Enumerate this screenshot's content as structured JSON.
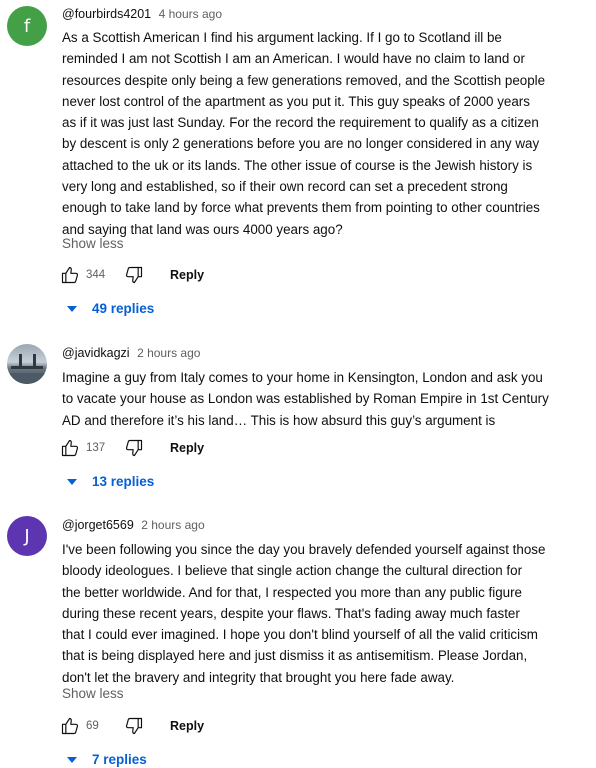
{
  "comments": [
    {
      "avatar_letter": "f",
      "avatar_color": "#43a047",
      "author": "@fourbirds4201",
      "time": "4 hours ago",
      "lines": [
        "As a Scottish American I find his argument lacking. If I go to Scotland ill be",
        "reminded I am not Scottish I am an American. I would have no claim to land or",
        "resources despite only being a few generations removed, and the Scottish people",
        "never lost control of the apartment as you put it. This guy speaks of 2000 years",
        "as if it was just last Sunday. For the record the requirement to qualify as a citizen",
        "by descent is only 2 generations before you are no longer considered in any way",
        "attached to the uk or its lands. The other issue of course is the Jewish history is",
        "very long and established, so if their own record can set a precedent strong",
        "enough to take land by force what prevents them from pointing to other countries",
        "and saying that land was ours 4000 years ago?"
      ],
      "show_less": "Show less",
      "likes": "344",
      "reply_label": "Reply",
      "replies_label": "49 replies"
    },
    {
      "avatar_icon": "bridge-photo",
      "author": "@javidkagzi",
      "time": "2 hours ago",
      "lines": [
        "Imagine a guy from Italy comes to your home in Kensington, London and ask you",
        "to vacate your house as London was established by Roman Empire in 1st Century",
        "AD and therefore it’s his land… This is how absurd this guy’s argument is"
      ],
      "likes": "137",
      "reply_label": "Reply",
      "replies_label": "13 replies"
    },
    {
      "avatar_letter": "J",
      "avatar_color": "#5e35b1",
      "author": "@jorget6569",
      "time": "2 hours ago",
      "lines": [
        "I've been following you since the day you bravely defended yourself against those",
        "bloody  ideologues. I believe that single action change the cultural direction for",
        "the better worldwide. And for that, I respected you more than any public figure",
        "during these recent years, despite your flaws. That's fading away much faster",
        "that I could ever imagined. I hope you don't blind yourself of all the valid criticism",
        "that is being displayed here and just dismiss it as antisemitism. Please Jordan,",
        "don't let the bravery and integrity that brought you here fade away."
      ],
      "show_less": "Show less",
      "likes": "69",
      "reply_label": "Reply",
      "replies_label": "7 replies"
    }
  ]
}
